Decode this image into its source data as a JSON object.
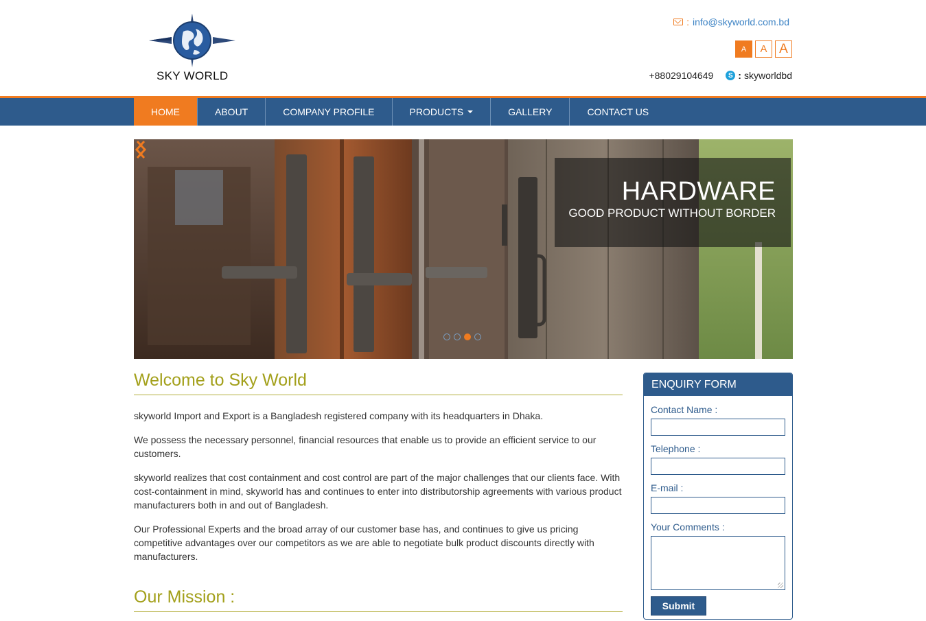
{
  "brand": {
    "name": "SKY WORLD"
  },
  "header": {
    "email_sep": ":",
    "email": "info@skyworld.com.bd",
    "font_sizes": [
      "A",
      "A",
      "A"
    ],
    "phone": "+88029104649",
    "skype_sep": ":",
    "skype": "skyworldbd"
  },
  "nav": {
    "items": [
      {
        "label": "HOME",
        "active": true
      },
      {
        "label": "ABOUT"
      },
      {
        "label": "COMPANY PROFILE"
      },
      {
        "label": "PRODUCTS",
        "dropdown": true
      },
      {
        "label": "GALLERY"
      },
      {
        "label": "CONTACT US"
      }
    ]
  },
  "slider": {
    "title": "HARDWARE",
    "subtitle": "GOOD PRODUCT WITHOUT BORDER",
    "slide_count": 4,
    "active_slide_index": 2
  },
  "main": {
    "welcome_title": "Welcome to Sky World",
    "paragraphs": [
      "skyworld Import and Export is a Bangladesh registered company with its headquarters in Dhaka.",
      "We possess the necessary personnel, financial resources that enable us to provide an efficient service to our customers.",
      "skyworld realizes that cost containment and cost control are part of the major challenges that our clients face. With cost-containment in mind, skyworld has and continues to enter into distributorship agreements with various product manufacturers both in and out of Bangladesh.",
      "Our Professional Experts and the broad array of our customer base has, and continues to give us pricing competitive advantages over our competitors as we are able to negotiate bulk product discounts directly with manufacturers."
    ],
    "mission_title": "Our Mission :"
  },
  "enquiry": {
    "title": "ENQUIRY FORM",
    "fields": {
      "name_label": "Contact Name :",
      "telephone_label": "Telephone :",
      "email_label": "E-mail :",
      "comments_label": "Your Comments :"
    },
    "submit_label": "Submit"
  },
  "colors": {
    "accent_orange": "#f07b20",
    "nav_blue": "#2e5b8c",
    "heading_olive": "#a3a01b",
    "link_blue": "#3b82c4"
  }
}
